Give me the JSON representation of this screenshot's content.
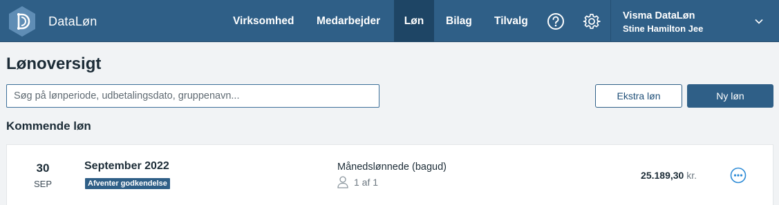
{
  "app": {
    "name": "DataLøn",
    "logo_icon": "dataløn-logo-icon"
  },
  "nav": {
    "items": [
      {
        "label": "Virksomhed"
      },
      {
        "label": "Medarbejder"
      },
      {
        "label": "Løn",
        "active": true
      },
      {
        "label": "Bilag"
      },
      {
        "label": "Tilvalg"
      }
    ],
    "help_icon": "help-circle-icon",
    "settings_icon": "gear-icon"
  },
  "account": {
    "title": "Visma DataLøn",
    "user": "Stine Hamilton Jee",
    "chevron_icon": "chevron-down-icon"
  },
  "page": {
    "title": "Lønoversigt",
    "search_placeholder": "Søg på lønperiode, udbetalingsdato, gruppenavn...",
    "search_value": "",
    "extra_button": "Ekstra løn",
    "new_button": "Ny løn",
    "section_title": "Kommende løn"
  },
  "payroll_runs": [
    {
      "day": "30",
      "month": "SEP",
      "period": "September 2022",
      "status": "Afventer godkendelse",
      "group": "Månedslønnede (bagud)",
      "employees": "1 af 1",
      "amount": "25.189,30",
      "currency": "kr."
    }
  ],
  "colors": {
    "primary": "#2f5f87",
    "nav_active": "#1e4565",
    "background": "#f1f3f5",
    "more_button": "#2b8ad6"
  }
}
